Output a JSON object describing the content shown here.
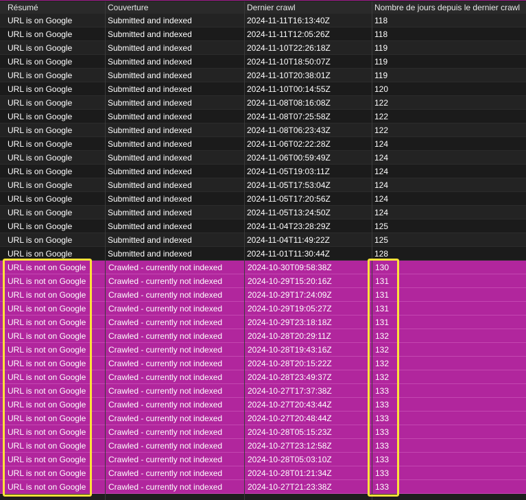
{
  "columns": [
    "Résumé",
    "Couverture",
    "Dernier crawl",
    "Nombre de jours depuis le dernier crawl"
  ],
  "rows": [
    [
      "URL is on Google",
      "Submitted and indexed",
      "2024-11-11T16:13:40Z",
      "118"
    ],
    [
      "URL is on Google",
      "Submitted and indexed",
      "2024-11-11T12:05:26Z",
      "118"
    ],
    [
      "URL is on Google",
      "Submitted and indexed",
      "2024-11-10T22:26:18Z",
      "119"
    ],
    [
      "URL is on Google",
      "Submitted and indexed",
      "2024-11-10T18:50:07Z",
      "119"
    ],
    [
      "URL is on Google",
      "Submitted and indexed",
      "2024-11-10T20:38:01Z",
      "119"
    ],
    [
      "URL is on Google",
      "Submitted and indexed",
      "2024-11-10T00:14:55Z",
      "120"
    ],
    [
      "URL is on Google",
      "Submitted and indexed",
      "2024-11-08T08:16:08Z",
      "122"
    ],
    [
      "URL is on Google",
      "Submitted and indexed",
      "2024-11-08T07:25:58Z",
      "122"
    ],
    [
      "URL is on Google",
      "Submitted and indexed",
      "2024-11-08T06:23:43Z",
      "122"
    ],
    [
      "URL is on Google",
      "Submitted and indexed",
      "2024-11-06T02:22:28Z",
      "124"
    ],
    [
      "URL is on Google",
      "Submitted and indexed",
      "2024-11-06T00:59:49Z",
      "124"
    ],
    [
      "URL is on Google",
      "Submitted and indexed",
      "2024-11-05T19:03:11Z",
      "124"
    ],
    [
      "URL is on Google",
      "Submitted and indexed",
      "2024-11-05T17:53:04Z",
      "124"
    ],
    [
      "URL is on Google",
      "Submitted and indexed",
      "2024-11-05T17:20:56Z",
      "124"
    ],
    [
      "URL is on Google",
      "Submitted and indexed",
      "2024-11-05T13:24:50Z",
      "124"
    ],
    [
      "URL is on Google",
      "Submitted and indexed",
      "2024-11-04T23:28:29Z",
      "125"
    ],
    [
      "URL is on Google",
      "Submitted and indexed",
      "2024-11-04T11:49:22Z",
      "125"
    ],
    [
      "URL is on Google",
      "Submitted and indexed",
      "2024-11-01T11:30:44Z",
      "128"
    ],
    [
      "URL is not on Google",
      "Crawled - currently not indexed",
      "2024-10-30T09:58:38Z",
      "130"
    ],
    [
      "URL is not on Google",
      "Crawled - currently not indexed",
      "2024-10-29T15:20:16Z",
      "131"
    ],
    [
      "URL is not on Google",
      "Crawled - currently not indexed",
      "2024-10-29T17:24:09Z",
      "131"
    ],
    [
      "URL is not on Google",
      "Crawled - currently not indexed",
      "2024-10-29T19:05:27Z",
      "131"
    ],
    [
      "URL is not on Google",
      "Crawled - currently not indexed",
      "2024-10-29T23:18:18Z",
      "131"
    ],
    [
      "URL is not on Google",
      "Crawled - currently not indexed",
      "2024-10-28T20:29:11Z",
      "132"
    ],
    [
      "URL is not on Google",
      "Crawled - currently not indexed",
      "2024-10-28T19:43:16Z",
      "132"
    ],
    [
      "URL is not on Google",
      "Crawled - currently not indexed",
      "2024-10-28T20:15:22Z",
      "132"
    ],
    [
      "URL is not on Google",
      "Crawled - currently not indexed",
      "2024-10-28T23:49:37Z",
      "132"
    ],
    [
      "URL is not on Google",
      "Crawled - currently not indexed",
      "2024-10-27T17:37:38Z",
      "133"
    ],
    [
      "URL is not on Google",
      "Crawled - currently not indexed",
      "2024-10-27T20:43:44Z",
      "133"
    ],
    [
      "URL is not on Google",
      "Crawled - currently not indexed",
      "2024-10-27T20:48:44Z",
      "133"
    ],
    [
      "URL is not on Google",
      "Crawled - currently not indexed",
      "2024-10-28T05:15:23Z",
      "133"
    ],
    [
      "URL is not on Google",
      "Crawled - currently not indexed",
      "2024-10-27T23:12:58Z",
      "133"
    ],
    [
      "URL is not on Google",
      "Crawled - currently not indexed",
      "2024-10-28T05:03:10Z",
      "133"
    ],
    [
      "URL is not on Google",
      "Crawled - currently not indexed",
      "2024-10-28T01:21:34Z",
      "133"
    ],
    [
      "URL is not on Google",
      "Crawled - currently not indexed",
      "2024-10-27T21:23:38Z",
      "133"
    ]
  ],
  "colors": {
    "indexed_row_bg": "#1b1b1b",
    "not_indexed_row_bg": "#b1269d",
    "highlight_border": "#ffe23a"
  }
}
